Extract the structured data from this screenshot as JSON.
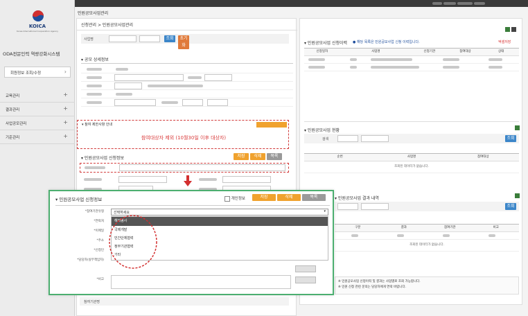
{
  "sidebar": {
    "logo_text": "KOICA",
    "logo_sub": "Korea International Cooperation Agency",
    "system_title": "ODA전문인력 역량강화시스템",
    "user_button": "회원정보 조회/수정",
    "menu": [
      "교육관리",
      "결과관리",
      "사업공모관리",
      "기준관리"
    ]
  },
  "topbar": {
    "page_path": "민원공모사업관리"
  },
  "left_panel": {
    "breadcrumb": "신청관리 > 민원공모사업관리",
    "search_label": "사업명",
    "search_button": "조회",
    "reset_button": "초기화",
    "detail_section": "공모 상세정보",
    "restriction_section": "참여 제한사항 안내",
    "restriction_message": "참여대상자 제외 (10월30일 이후 대상자)",
    "apply_section": "민원공모사업 신청정보",
    "apply_buttons": [
      "저장",
      "삭제",
      "목록"
    ],
    "bottom_field": "참여기관명"
  },
  "popup": {
    "title": "민원공모사업 신청정보",
    "checkbox_label": "개인정보",
    "buttons": [
      "저장",
      "삭제",
      "목록"
    ],
    "field_labels": [
      "*참여기관유형",
      "*연락처",
      "*이메일",
      "*주소",
      "*신청인",
      "*담당자(실무책임자)",
      "*비고"
    ],
    "select_value": "선택하세요",
    "dropdown_options": [
      "해외봉사",
      "국제개발",
      "민간단체협력",
      "정부기관협력",
      "기타"
    ],
    "dropdown_selected_index": 0
  },
  "right_panel": {
    "top_section": "민원공모사업 신청이력",
    "top_info": "해당 목록은 민원공모사업 신청 이력입니다.",
    "excel_button": "엑셀저장",
    "top_columns": [
      "신청일자",
      "사업명",
      "신청기관",
      "참여대상",
      "상태"
    ],
    "mid_section": "민원공모사업 현황",
    "mid_search_label": "검색",
    "mid_search_button": "조회",
    "mid_columns": [
      "순번",
      "사업명",
      "참여대상"
    ],
    "mid_empty": "조회된 데이터가 없습니다.",
    "bottom_section": "민원공모사업 결과 내역",
    "bottom_search_button": "조회",
    "bottom_columns": [
      "구분",
      "결과",
      "참여기관",
      "비고"
    ],
    "bottom_empty": "조회된 데이터가 없습니다.",
    "footnotes": [
      "※ 민원공모사업 신청이력 및 결과는 사업별로 조회 가능합니다.",
      "※ 민원 신청 관련 문의는 담당자에게 연락 바랍니다."
    ]
  },
  "colors": {
    "orange": "#f0a22e",
    "blue": "#3c86c9",
    "red_accent": "#d93b3b",
    "frame_green": "#4caf70",
    "sidebar_bg": "#ececec",
    "dropdown_selected": "#555555"
  }
}
